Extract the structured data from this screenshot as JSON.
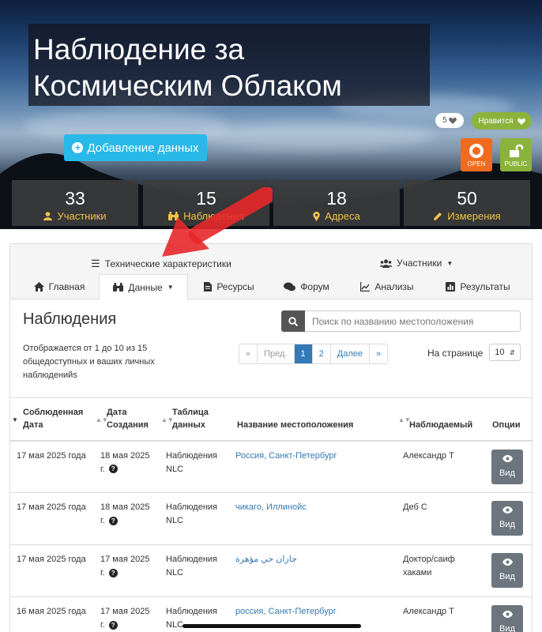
{
  "hero": {
    "title_line1": "Наблюдение за",
    "title_line2": "Космическим Облаком",
    "add_button": "Добавление данных",
    "like_count": "5",
    "like_label": "Нравится",
    "badge_open": "OPEN",
    "badge_public": "PUBLIC"
  },
  "stats": [
    {
      "value": "33",
      "label": "Участники",
      "icon": "user-icon"
    },
    {
      "value": "15",
      "label": "Наблюдения",
      "icon": "binoculars-icon"
    },
    {
      "value": "18",
      "label": "Адреса",
      "icon": "map-marker-icon"
    },
    {
      "value": "50",
      "label": "Измерения",
      "icon": "pencil-icon"
    }
  ],
  "subnav": {
    "tech": "Технические характеристики",
    "members": "Участники"
  },
  "tabs": [
    {
      "label": "Главная",
      "icon": "home-icon"
    },
    {
      "label": "Данные",
      "icon": "binoculars-icon"
    },
    {
      "label": "Ресурсы",
      "icon": "file-icon"
    },
    {
      "label": "Форум",
      "icon": "comments-icon"
    },
    {
      "label": "Анализы",
      "icon": "line-chart-icon"
    },
    {
      "label": "Результаты",
      "icon": "bar-chart-icon"
    }
  ],
  "observations": {
    "title": "Наблюдения",
    "search_placeholder": "Поиск по названию местоположения",
    "showing": "Отображается от 1 до 10 из 15 общедоступных и ваших личных наблюденийs",
    "pager": {
      "first": "«",
      "prev": "Пред.",
      "p1": "1",
      "p2": "2",
      "next": "Далее",
      "last": "»"
    },
    "per_page_label": "На странице",
    "per_page_value": "10"
  },
  "table": {
    "headers": {
      "observed": "Соблюденная Дата",
      "created": "Дата Создания",
      "datasheet": "Таблица данных",
      "location": "Название местоположения",
      "observer": "Наблюдаемый",
      "options": "Опции"
    },
    "view_label": "Вид",
    "rows": [
      {
        "observed": "17 мая 2025 года",
        "created": "18 мая 2025 г.",
        "datasheet": "Наблюдения NLC",
        "location": "Россия, Санкт-Петербург",
        "observer": "Александр Т"
      },
      {
        "observed": "17 мая 2025 года",
        "created": "18 мая 2025 г.",
        "datasheet": "Наблюдения NLC",
        "location": "чикаго, Иллинойс",
        "observer": "Деб С"
      },
      {
        "observed": "17 мая 2025 года",
        "created": "17 мая 2025 г.",
        "datasheet": "Наблюдения NLC",
        "location": "جازان حي مؤهرة",
        "observer": "Доктор/саиф хаками"
      },
      {
        "observed": "16 мая 2025 года",
        "created": "17 мая 2025 г.",
        "datasheet": "Наблюдения NLC",
        "location": "россия, Санкт-Петербург",
        "observer": "Александр Т"
      }
    ]
  }
}
